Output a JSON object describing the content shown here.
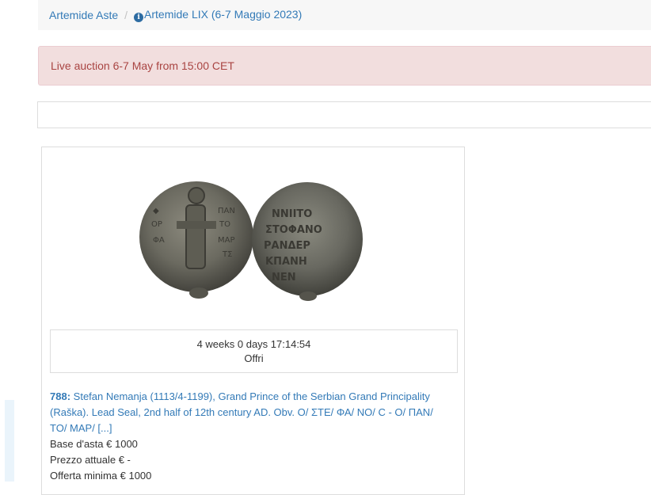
{
  "breadcrumb": {
    "home": "Artemide Aste",
    "separator": "/",
    "current": "Artemide LIX (6-7 Maggio 2023)",
    "info_icon": "info-circle-icon"
  },
  "alert": {
    "text": "Live auction 6-7 May from 15:00 CET"
  },
  "lot": {
    "image_icon": "lead-seal-photo",
    "countdown": "4 weeks 0 days 17:14:54",
    "offer_label": "Offri",
    "number": "788:",
    "description_line1": "Stefan Nemanja (1113/4-1199), Grand Prince of the Serbian Grand Principality",
    "description_line2": "(Raška). Lead Seal, 2nd half of 12th century AD. Obv. O/ ΣΤΕ/ ΦΑ/ ΝΟ/ C - O/ ΠΑΝ/",
    "description_line3": "ΤΟ/ ΜΑΡ/ [...]",
    "starting_price": "Base d'asta € 1000",
    "current_price": "Prezzo attuale € -",
    "minimum_offer": "Offerta minima € 1000"
  },
  "colors": {
    "link": "#337ab7",
    "alert_bg": "#f2dede",
    "alert_text": "#a94442"
  }
}
